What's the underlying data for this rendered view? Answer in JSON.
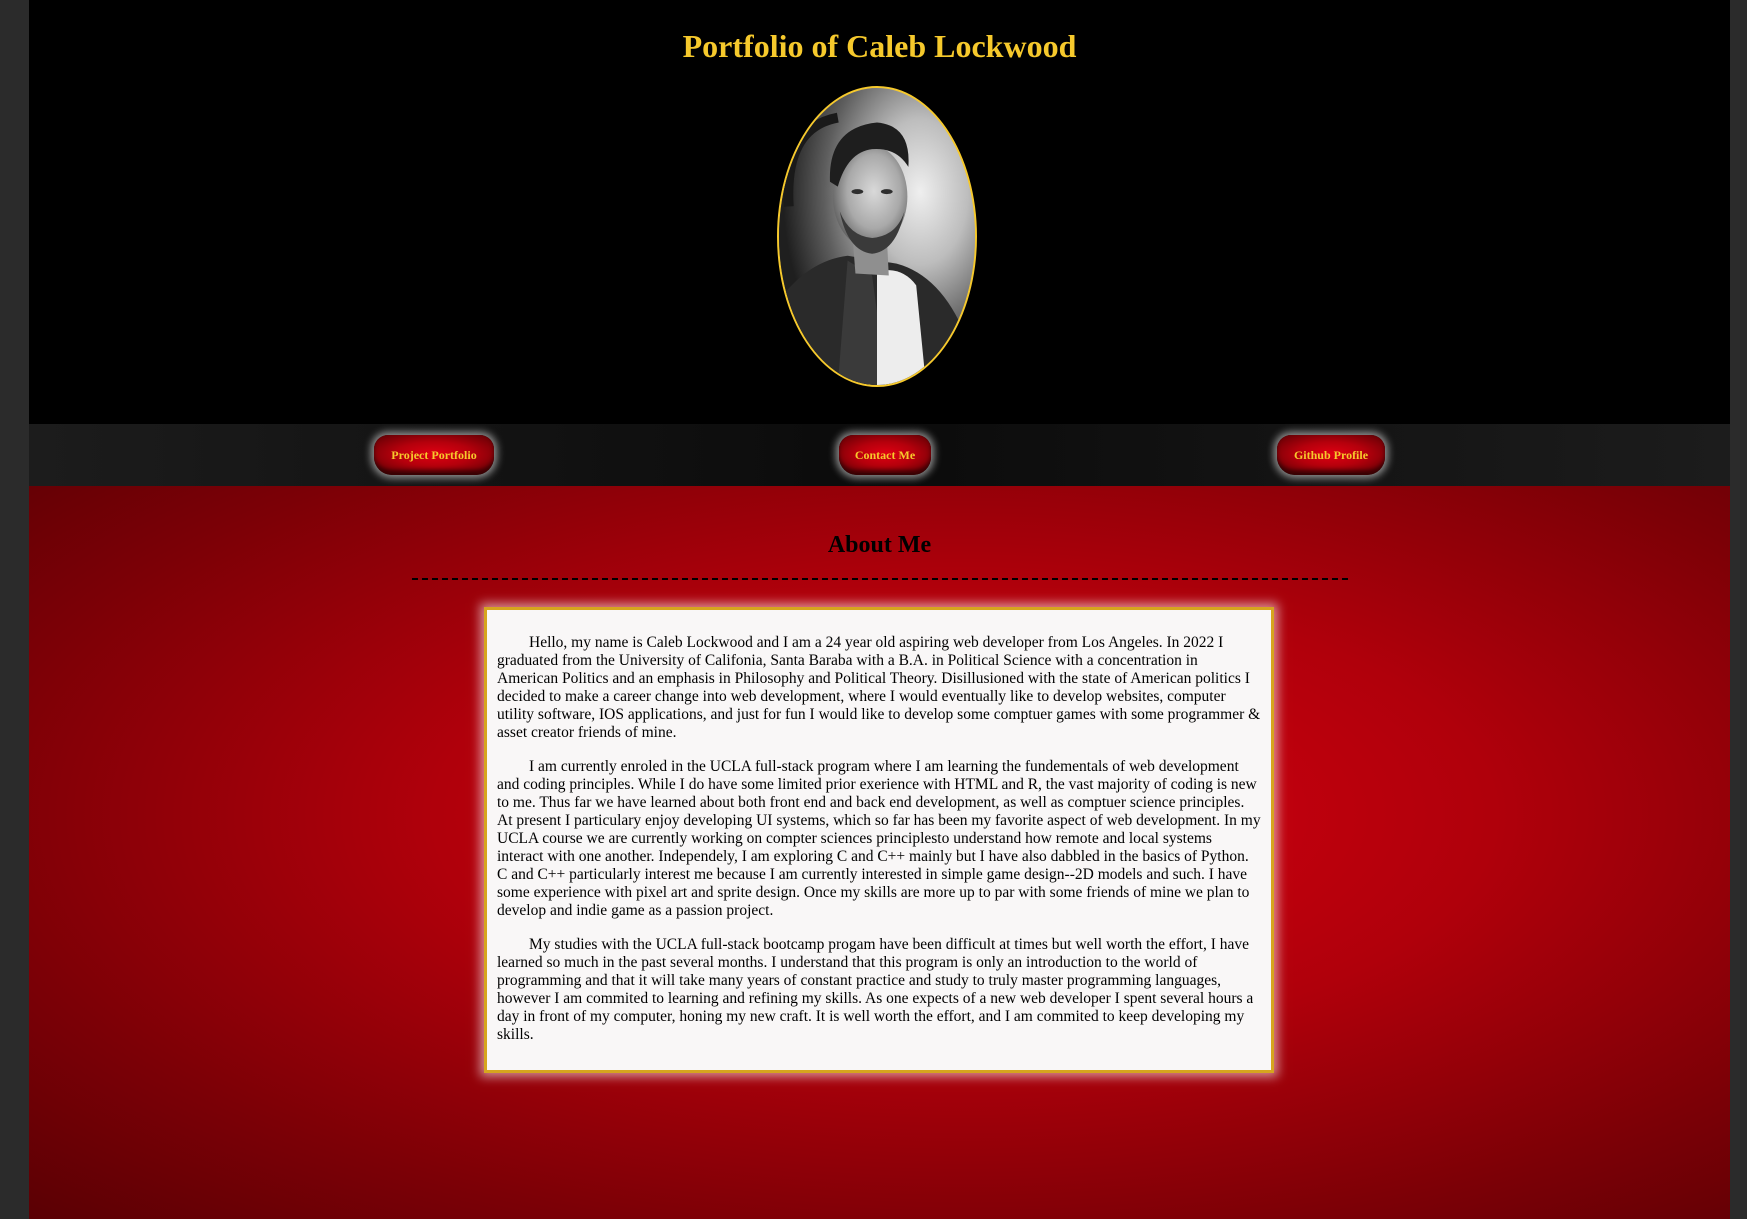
{
  "header": {
    "title": "Portfolio of Caleb Lockwood",
    "portrait_alt": "Portrait of Caleb Lockwood"
  },
  "nav": {
    "items": [
      {
        "label": "Project Portfolio"
      },
      {
        "label": "Contact Me"
      },
      {
        "label": "Github Profile"
      }
    ]
  },
  "about": {
    "heading": "About Me",
    "paragraphs": [
      "Hello, my name is Caleb Lockwood and I am a 24 year old aspiring web developer from Los Angeles. In 2022 I graduated from the University of Califonia, Santa Baraba with a B.A. in Political Science with a concentration in American Politics and an emphasis in Philosophy and Political Theory. Disillusioned with the state of American politics I decided to make a career change into web development, where I would eventually like to develop websites, computer utility software, IOS applications, and just for fun I would like to develop some comptuer games with some programmer & asset creator friends of mine.",
      "I am currently enroled in the UCLA full-stack program where I am learning the fundementals of web development and coding principles. While I do have some limited prior exerience with HTML and R, the vast majority of coding is new to me. Thus far we have learned about both front end and back end development, as well as comptuer science principles. At present I particulary enjoy developing UI systems, which so far has been my favorite aspect of web development. In my UCLA course we are currently working on compter sciences principlesto understand how remote and local systems interact with one another. Independely, I am exploring C and C++ mainly but I have also dabbled in the basics of Python. C and C++ particularly interest me because I am currently interested in simple game design--2D models and such. I have some experience with pixel art and sprite design. Once my skills are more up to par with some friends of mine we plan to develop and indie game as a passion project.",
      "My studies with the UCLA full-stack bootcamp progam have been difficult at times but well worth the effort, I have learned so much in the past several months. I understand that this program is only an introduction to the world of programming and that it will take many years of constant practice and study to truly master programming languages, however I am commited to learning and refining my skills. As one expects of a new web developer I spent several hours a day in front of my computer, honing my new craft. It is well worth the effort, and I am commited to keep developing my skills."
    ]
  },
  "colors": {
    "accent_gold": "#f6c92c",
    "header_bg": "#000000",
    "about_bg": "#c0000e",
    "card_bg": "#f9f7f7",
    "card_border": "#d6a51e"
  }
}
